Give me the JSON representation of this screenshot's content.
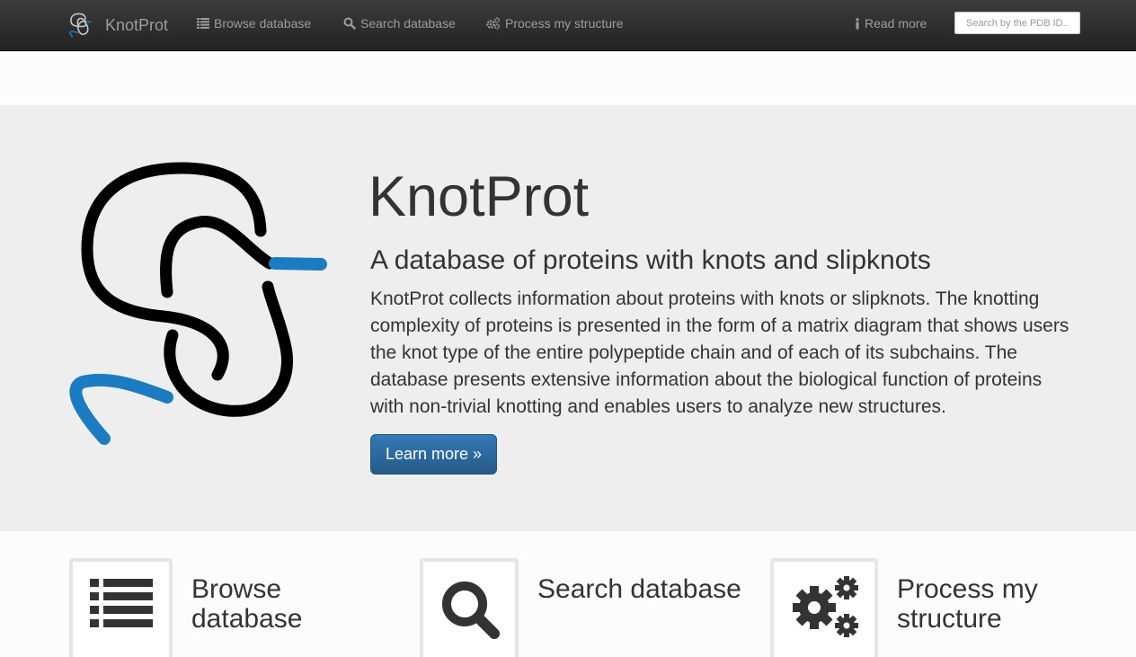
{
  "navbar": {
    "brand": "KnotProt",
    "items": [
      {
        "label": "Browse database",
        "icon": "list-icon"
      },
      {
        "label": "Search database",
        "icon": "search-icon"
      },
      {
        "label": "Process my structure",
        "icon": "cogs-icon"
      }
    ],
    "read_more": {
      "label": "Read more",
      "icon": "info-icon"
    },
    "search": {
      "placeholder": "Search by the PDB ID..",
      "value": ""
    }
  },
  "hero": {
    "title": "KnotProt",
    "subtitle": "A database of proteins with knots and slipknots",
    "description": "KnotProt collects information about proteins with knots or slipknots. The knotting complexity of proteins is presented in the form of a matrix diagram that shows users the knot type of the entire polypeptide chain and of each of its subchains. The database presents extensive information about the biological function of proteins with non-trivial knotting and enables users to analyze new structures.",
    "button_label": "Learn more »"
  },
  "features": [
    {
      "title": "Browse database",
      "icon": "list-icon"
    },
    {
      "title": "Search database",
      "icon": "search-icon"
    },
    {
      "title": "Process my structure",
      "icon": "cogs-icon"
    }
  ],
  "colors": {
    "navbar_bg": "#222222",
    "nav_text": "#9d9d9d",
    "jumbotron_bg": "#eeeeee",
    "primary_button": "#337ab7",
    "knot_black": "#000000",
    "knot_blue": "#1a7cc1"
  }
}
